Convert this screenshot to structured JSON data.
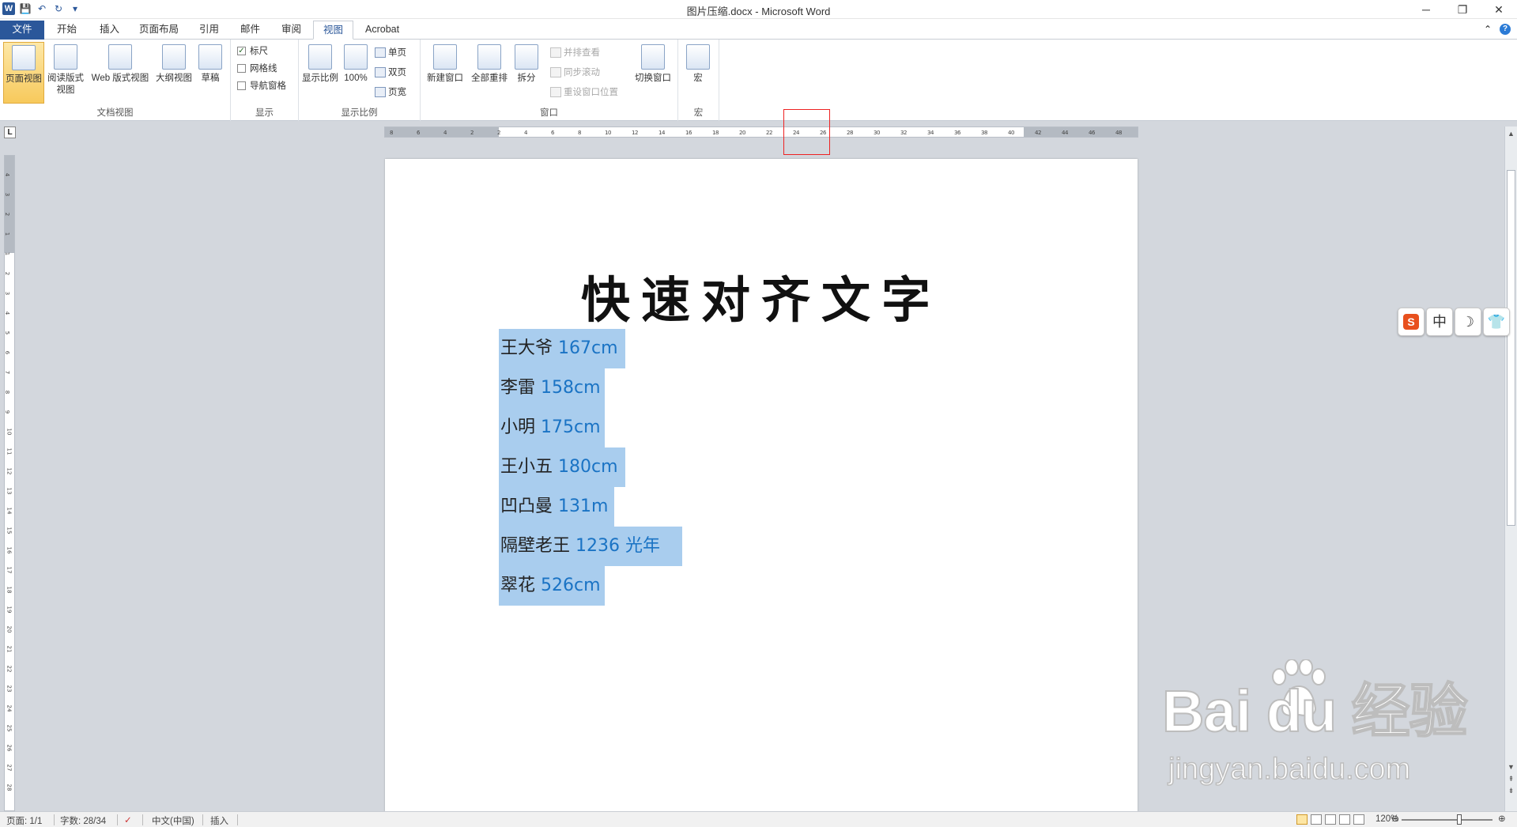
{
  "window": {
    "title": "图片压缩.docx - Microsoft Word",
    "minimize": "─",
    "restore": "❐",
    "close": "✕"
  },
  "qat": {
    "logo": "W",
    "save": "💾",
    "undo": "↶",
    "redo": "↻",
    "more": "▾"
  },
  "tabs": [
    "文件",
    "开始",
    "插入",
    "页面布局",
    "引用",
    "邮件",
    "审阅",
    "视图",
    "Acrobat"
  ],
  "ribbon": {
    "views": {
      "label": "文档视图",
      "buttons": [
        "页面视图",
        "阅读版式\n视图",
        "Web 版式视图",
        "大纲视图",
        "草稿"
      ]
    },
    "show": {
      "label": "显示",
      "items": [
        {
          "text": "标尺",
          "checked": true
        },
        {
          "text": "网格线",
          "checked": false
        },
        {
          "text": "导航窗格",
          "checked": false
        }
      ]
    },
    "zoom": {
      "label": "显示比例",
      "zoom_btn": "显示比例",
      "pct_btn": "100%",
      "one": "单页",
      "two": "双页",
      "width": "页宽"
    },
    "window": {
      "label": "窗口",
      "new": "新建窗口",
      "arrange": "全部重排",
      "split": "拆分",
      "side": "并排查看",
      "sync": "同步滚动",
      "reset": "重设窗口位置",
      "switch": "切换窗口"
    },
    "macro": {
      "label": "宏",
      "btn": "宏"
    }
  },
  "ruler": {
    "h_ticks": [
      "8",
      "6",
      "4",
      "2",
      "2",
      "4",
      "6",
      "8",
      "10",
      "12",
      "14",
      "16",
      "18",
      "20",
      "22",
      "24",
      "26",
      "28",
      "30",
      "32",
      "34",
      "36",
      "38",
      "40",
      "42",
      "44",
      "46",
      "48"
    ],
    "v_ticks": [
      "4",
      "3",
      "2",
      "1",
      "1",
      "2",
      "3",
      "4",
      "5",
      "6",
      "7",
      "8",
      "9",
      "10",
      "11",
      "12",
      "13",
      "14",
      "15",
      "16",
      "17",
      "18",
      "19",
      "20",
      "21",
      "22",
      "23",
      "24",
      "25",
      "26",
      "27",
      "28"
    ]
  },
  "document": {
    "title": "快速对齐文字",
    "lines": [
      {
        "name": "王大爷",
        "value": "167cm"
      },
      {
        "name": "李雷",
        "value": "158cm"
      },
      {
        "name": "小明",
        "value": "175cm"
      },
      {
        "name": "王小五",
        "value": "180cm"
      },
      {
        "name": "凹凸曼",
        "value": "131m"
      },
      {
        "name": "隔壁老王",
        "value": "1236 光年"
      },
      {
        "name": "翠花",
        "value": "526cm"
      }
    ]
  },
  "ime": {
    "logo": "S",
    "lang": "中",
    "moon": "☽",
    "skin": "👕"
  },
  "status": {
    "page": "页面: 1/1",
    "words": "字数: 28/34",
    "lang": "中文(中国)",
    "mode": "插入",
    "zoom": "120%",
    "minus": "⊖",
    "plus": "⊕"
  },
  "watermark": {
    "brand": "Bai  du 经验",
    "url": "jingyan.baidu.com"
  }
}
